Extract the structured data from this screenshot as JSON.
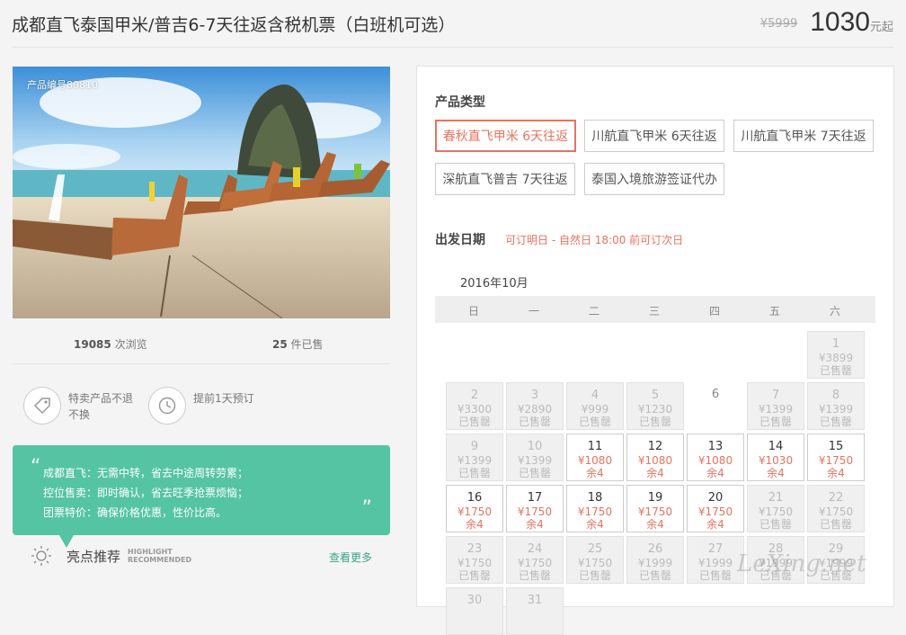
{
  "header": {
    "title": "成都直飞泰国甲米/普吉6-7天往返含税机票（白班机可选）",
    "old_price": "¥5999",
    "price": "1030",
    "price_unit": "元起"
  },
  "product": {
    "number_label": "产品编号80810",
    "views_value": "19085",
    "views_label": " 次浏览",
    "sold_value": "25",
    "sold_label": " 件已售"
  },
  "features": [
    {
      "icon": "tag-icon",
      "text": "特卖产品不退不换"
    },
    {
      "icon": "clock-icon",
      "text": "提前1天预订"
    }
  ],
  "highlight_box": {
    "lines": [
      "成都直飞：无需中转，省去中途周转劳累；",
      "控位售卖：即时确认，省去旺季抢票烦恼；",
      "团票特价：确保价格优惠，性价比高。"
    ],
    "open_quote": "“",
    "close_quote": "”"
  },
  "highlight": {
    "title": "亮点推荐",
    "en_line1": "HIGHLIGHT",
    "en_line2": "RECOMMENDED",
    "more": "查看更多"
  },
  "booking": {
    "type_label": "产品类型",
    "options": [
      {
        "label": "春秋直飞甲米 6天往返",
        "active": true
      },
      {
        "label": "川航直飞甲米 6天往返",
        "active": false
      },
      {
        "label": "川航直飞甲米 7天往返",
        "active": false
      },
      {
        "label": "深航直飞普吉 7天往返",
        "active": false
      },
      {
        "label": "泰国入境旅游签证代办",
        "active": false
      }
    ],
    "date_label": "出发日期",
    "date_note": "可订明日 - 自然日 18:00 前可订次日",
    "month": "2016年10月",
    "weekdays": [
      "日",
      "一",
      "二",
      "三",
      "四",
      "五",
      "六"
    ]
  },
  "calendar": [
    {
      "day": "1",
      "price": "¥3899",
      "status": "已售罄",
      "state": "off"
    },
    {
      "day": "2",
      "price": "¥3300",
      "status": "已售罄",
      "state": "off"
    },
    {
      "day": "3",
      "price": "¥2890",
      "status": "已售罄",
      "state": "off"
    },
    {
      "day": "4",
      "price": "¥999",
      "status": "已售罄",
      "state": "off"
    },
    {
      "day": "5",
      "price": "¥1230",
      "status": "已售罄",
      "state": "off"
    },
    {
      "day": "6",
      "price": "",
      "status": "",
      "state": "blank"
    },
    {
      "day": "7",
      "price": "¥1399",
      "status": "已售罄",
      "state": "off"
    },
    {
      "day": "8",
      "price": "¥1399",
      "status": "已售罄",
      "state": "off"
    },
    {
      "day": "9",
      "price": "¥1399",
      "status": "已售罄",
      "state": "off"
    },
    {
      "day": "10",
      "price": "¥1399",
      "status": "已售罄",
      "state": "off"
    },
    {
      "day": "11",
      "price": "¥1080",
      "status": "余4",
      "state": "on"
    },
    {
      "day": "12",
      "price": "¥1080",
      "status": "余4",
      "state": "on"
    },
    {
      "day": "13",
      "price": "¥1080",
      "status": "余4",
      "state": "on"
    },
    {
      "day": "14",
      "price": "¥1030",
      "status": "余4",
      "state": "on"
    },
    {
      "day": "15",
      "price": "¥1750",
      "status": "余4",
      "state": "on"
    },
    {
      "day": "16",
      "price": "¥1750",
      "status": "余4",
      "state": "on"
    },
    {
      "day": "17",
      "price": "¥1750",
      "status": "余4",
      "state": "on"
    },
    {
      "day": "18",
      "price": "¥1750",
      "status": "余4",
      "state": "on"
    },
    {
      "day": "19",
      "price": "¥1750",
      "status": "余4",
      "state": "on"
    },
    {
      "day": "20",
      "price": "¥1750",
      "status": "余4",
      "state": "on"
    },
    {
      "day": "21",
      "price": "¥1750",
      "status": "已售罄",
      "state": "off"
    },
    {
      "day": "22",
      "price": "¥1750",
      "status": "已售罄",
      "state": "off"
    },
    {
      "day": "23",
      "price": "¥1750",
      "status": "已售罄",
      "state": "off"
    },
    {
      "day": "24",
      "price": "¥1750",
      "status": "已售罄",
      "state": "off"
    },
    {
      "day": "25",
      "price": "¥1750",
      "status": "已售罄",
      "state": "off"
    },
    {
      "day": "26",
      "price": "¥1999",
      "status": "已售罄",
      "state": "off"
    },
    {
      "day": "27",
      "price": "¥1999",
      "status": "已售罄",
      "state": "off"
    },
    {
      "day": "28",
      "price": "¥1999",
      "status": "已售罄",
      "state": "off"
    },
    {
      "day": "29",
      "price": "¥1999",
      "status": "已售罄",
      "state": "off"
    },
    {
      "day": "30",
      "price": "",
      "status": "",
      "state": "off"
    },
    {
      "day": "31",
      "price": "",
      "status": "",
      "state": "off"
    }
  ],
  "calendar_first_weekday": 6,
  "watermark": "LeXing.net",
  "colors": {
    "accent": "#e8735f",
    "green": "#55c4a3",
    "link_green": "#3aa58a"
  }
}
